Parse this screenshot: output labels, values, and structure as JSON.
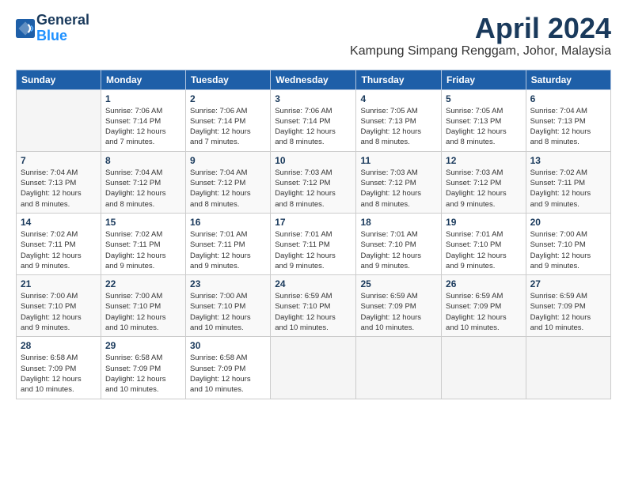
{
  "logo": {
    "line1": "General",
    "line2": "Blue"
  },
  "title": "April 2024",
  "location": "Kampung Simpang Renggam, Johor, Malaysia",
  "days_header": [
    "Sunday",
    "Monday",
    "Tuesday",
    "Wednesday",
    "Thursday",
    "Friday",
    "Saturday"
  ],
  "weeks": [
    [
      {
        "num": "",
        "info": ""
      },
      {
        "num": "1",
        "info": "Sunrise: 7:06 AM\nSunset: 7:14 PM\nDaylight: 12 hours\nand 7 minutes."
      },
      {
        "num": "2",
        "info": "Sunrise: 7:06 AM\nSunset: 7:14 PM\nDaylight: 12 hours\nand 7 minutes."
      },
      {
        "num": "3",
        "info": "Sunrise: 7:06 AM\nSunset: 7:14 PM\nDaylight: 12 hours\nand 8 minutes."
      },
      {
        "num": "4",
        "info": "Sunrise: 7:05 AM\nSunset: 7:13 PM\nDaylight: 12 hours\nand 8 minutes."
      },
      {
        "num": "5",
        "info": "Sunrise: 7:05 AM\nSunset: 7:13 PM\nDaylight: 12 hours\nand 8 minutes."
      },
      {
        "num": "6",
        "info": "Sunrise: 7:04 AM\nSunset: 7:13 PM\nDaylight: 12 hours\nand 8 minutes."
      }
    ],
    [
      {
        "num": "7",
        "info": "Sunrise: 7:04 AM\nSunset: 7:13 PM\nDaylight: 12 hours\nand 8 minutes."
      },
      {
        "num": "8",
        "info": "Sunrise: 7:04 AM\nSunset: 7:12 PM\nDaylight: 12 hours\nand 8 minutes."
      },
      {
        "num": "9",
        "info": "Sunrise: 7:04 AM\nSunset: 7:12 PM\nDaylight: 12 hours\nand 8 minutes."
      },
      {
        "num": "10",
        "info": "Sunrise: 7:03 AM\nSunset: 7:12 PM\nDaylight: 12 hours\nand 8 minutes."
      },
      {
        "num": "11",
        "info": "Sunrise: 7:03 AM\nSunset: 7:12 PM\nDaylight: 12 hours\nand 8 minutes."
      },
      {
        "num": "12",
        "info": "Sunrise: 7:03 AM\nSunset: 7:12 PM\nDaylight: 12 hours\nand 9 minutes."
      },
      {
        "num": "13",
        "info": "Sunrise: 7:02 AM\nSunset: 7:11 PM\nDaylight: 12 hours\nand 9 minutes."
      }
    ],
    [
      {
        "num": "14",
        "info": "Sunrise: 7:02 AM\nSunset: 7:11 PM\nDaylight: 12 hours\nand 9 minutes."
      },
      {
        "num": "15",
        "info": "Sunrise: 7:02 AM\nSunset: 7:11 PM\nDaylight: 12 hours\nand 9 minutes."
      },
      {
        "num": "16",
        "info": "Sunrise: 7:01 AM\nSunset: 7:11 PM\nDaylight: 12 hours\nand 9 minutes."
      },
      {
        "num": "17",
        "info": "Sunrise: 7:01 AM\nSunset: 7:11 PM\nDaylight: 12 hours\nand 9 minutes."
      },
      {
        "num": "18",
        "info": "Sunrise: 7:01 AM\nSunset: 7:10 PM\nDaylight: 12 hours\nand 9 minutes."
      },
      {
        "num": "19",
        "info": "Sunrise: 7:01 AM\nSunset: 7:10 PM\nDaylight: 12 hours\nand 9 minutes."
      },
      {
        "num": "20",
        "info": "Sunrise: 7:00 AM\nSunset: 7:10 PM\nDaylight: 12 hours\nand 9 minutes."
      }
    ],
    [
      {
        "num": "21",
        "info": "Sunrise: 7:00 AM\nSunset: 7:10 PM\nDaylight: 12 hours\nand 9 minutes."
      },
      {
        "num": "22",
        "info": "Sunrise: 7:00 AM\nSunset: 7:10 PM\nDaylight: 12 hours\nand 10 minutes."
      },
      {
        "num": "23",
        "info": "Sunrise: 7:00 AM\nSunset: 7:10 PM\nDaylight: 12 hours\nand 10 minutes."
      },
      {
        "num": "24",
        "info": "Sunrise: 6:59 AM\nSunset: 7:10 PM\nDaylight: 12 hours\nand 10 minutes."
      },
      {
        "num": "25",
        "info": "Sunrise: 6:59 AM\nSunset: 7:09 PM\nDaylight: 12 hours\nand 10 minutes."
      },
      {
        "num": "26",
        "info": "Sunrise: 6:59 AM\nSunset: 7:09 PM\nDaylight: 12 hours\nand 10 minutes."
      },
      {
        "num": "27",
        "info": "Sunrise: 6:59 AM\nSunset: 7:09 PM\nDaylight: 12 hours\nand 10 minutes."
      }
    ],
    [
      {
        "num": "28",
        "info": "Sunrise: 6:58 AM\nSunset: 7:09 PM\nDaylight: 12 hours\nand 10 minutes."
      },
      {
        "num": "29",
        "info": "Sunrise: 6:58 AM\nSunset: 7:09 PM\nDaylight: 12 hours\nand 10 minutes."
      },
      {
        "num": "30",
        "info": "Sunrise: 6:58 AM\nSunset: 7:09 PM\nDaylight: 12 hours\nand 10 minutes."
      },
      {
        "num": "",
        "info": ""
      },
      {
        "num": "",
        "info": ""
      },
      {
        "num": "",
        "info": ""
      },
      {
        "num": "",
        "info": ""
      }
    ]
  ]
}
